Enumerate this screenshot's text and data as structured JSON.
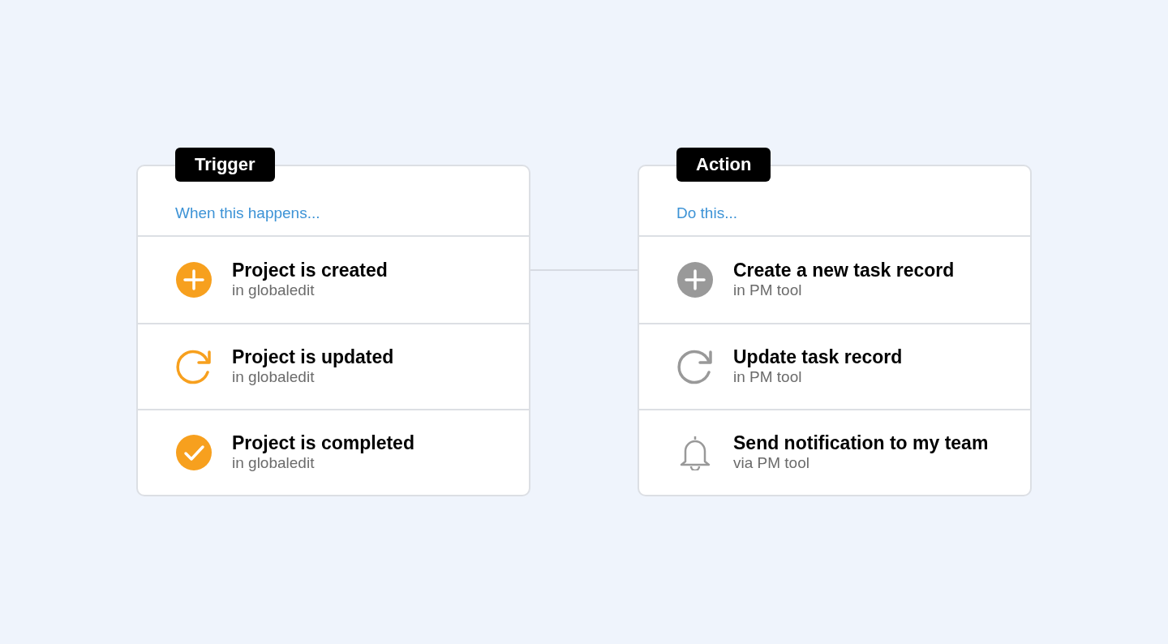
{
  "cards": [
    {
      "tag": "Trigger",
      "heading": "When this happens...",
      "color": "#f7a01e",
      "items": [
        {
          "kind": "plus",
          "title": "Project is created",
          "subtitle": "in globaledit"
        },
        {
          "kind": "refresh",
          "title": "Project is updated",
          "subtitle": "in globaledit"
        },
        {
          "kind": "check",
          "title": "Project is completed",
          "subtitle": "in globaledit"
        }
      ]
    },
    {
      "tag": "Action",
      "heading": "Do this...",
      "color": "#999999",
      "items": [
        {
          "kind": "plus",
          "title": "Create a new task record",
          "subtitle": "in PM tool"
        },
        {
          "kind": "refresh",
          "title": "Update task record",
          "subtitle": "in PM tool"
        },
        {
          "kind": "bell",
          "title": "Send notification to my team",
          "subtitle": "via PM tool"
        }
      ]
    }
  ]
}
